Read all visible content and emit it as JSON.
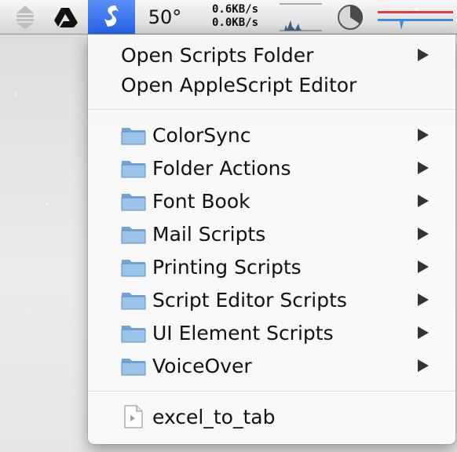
{
  "menubar": {
    "temperature": "50°",
    "net_up": "0.6KB/s",
    "net_down": "0.0KB/s",
    "icons": [
      "updown-arrows-icon",
      "google-drive-icon",
      "script-menu-icon",
      "clock-icon",
      "network-graph-icon",
      "meter-icon"
    ]
  },
  "menu": {
    "top_items": [
      {
        "label": "Open Scripts Folder",
        "has_submenu": true
      },
      {
        "label": "Open AppleScript Editor",
        "has_submenu": false
      }
    ],
    "folders": [
      {
        "label": "ColorSync"
      },
      {
        "label": "Folder Actions"
      },
      {
        "label": "Font Book"
      },
      {
        "label": "Mail Scripts"
      },
      {
        "label": "Printing Scripts"
      },
      {
        "label": "Script Editor Scripts"
      },
      {
        "label": "UI Element Scripts"
      },
      {
        "label": "VoiceOver"
      }
    ],
    "scripts": [
      {
        "label": "excel_to_tab"
      }
    ]
  },
  "colors": {
    "menubar_highlight": "#2563e8",
    "folder": "#7fb1e0"
  }
}
